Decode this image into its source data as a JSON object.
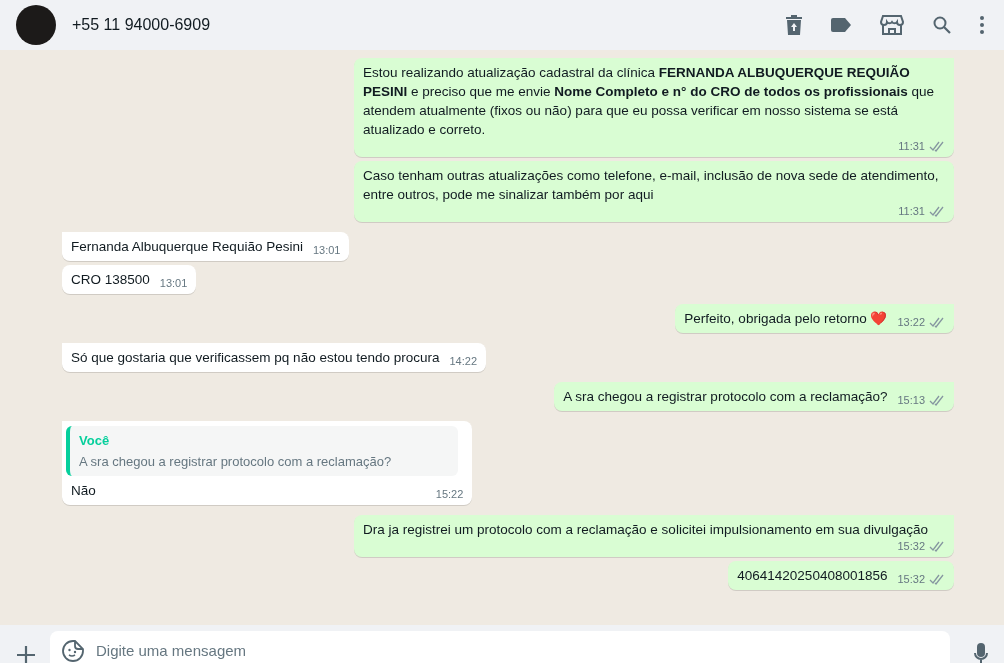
{
  "header": {
    "contact": "+55 11 94000-6909"
  },
  "messages": [
    {
      "kind": "outgoing",
      "text": "Estou realizando atualização cadastral da clínica **FERNANDA ALBUQUERQUE REQUIÃO PESINI** e preciso que me envie **Nome Completo e n° do CRO de todos os profissionais** que atendem atualmente (fixos ou não) para que eu possa verificar em nosso sistema se está atualizado e correto.",
      "time": "11:31",
      "read": false
    },
    {
      "kind": "outgoing",
      "text": "Caso tenham outras atualizações como telefone, e-mail, inclusão de nova sede de atendimento, entre outros, pode me sinalizar também por aqui",
      "time": "11:31",
      "read": false
    },
    {
      "kind": "incoming",
      "text": "Fernanda Albuquerque Requião Pesini",
      "time": "13:01"
    },
    {
      "kind": "incoming",
      "text": "CRO 138500",
      "time": "13:01"
    },
    {
      "kind": "outgoing",
      "text": "Perfeito, obrigada pelo retorno ❤️",
      "time": "13:22",
      "read": false
    },
    {
      "kind": "incoming",
      "text": "Só que gostaria que verificassem pq não estou tendo procura",
      "time": "14:22"
    },
    {
      "kind": "outgoing",
      "text": "A sra chegou a registrar protocolo com a reclamação?",
      "time": "15:13",
      "read": false
    },
    {
      "kind": "incoming",
      "quote": {
        "author": "Você",
        "text": "A sra chegou a registrar protocolo com a reclamação?"
      },
      "text": "Não",
      "time": "15:22"
    },
    {
      "kind": "outgoing",
      "text": "Dra ja registrei um protocolo com a reclamação e solicitei impulsionamento em sua divulgação",
      "time": "15:32",
      "read": false
    },
    {
      "kind": "outgoing",
      "text": "40641420250408001856",
      "time": "15:32",
      "read": false
    }
  ],
  "composer": {
    "placeholder": "Digite uma mensagem"
  }
}
